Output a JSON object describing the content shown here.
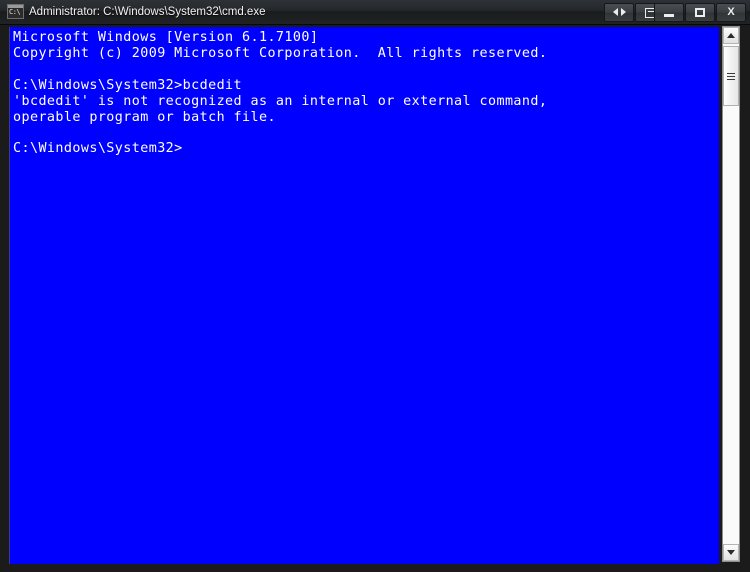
{
  "window": {
    "title": "Administrator: C:\\Windows\\System32\\cmd.exe",
    "icon_name": "cmd-console-icon",
    "icon_label": "C:\\",
    "background_color": "#0000ff",
    "titlebar_color": "#24272a",
    "text_color": "#ffffff"
  },
  "connection_bar": {
    "buttons": [
      {
        "name": "restore-arrows-button",
        "label": "Restore size",
        "glyph": "arrows-left-right-icon"
      },
      {
        "name": "disconnect-button",
        "label": "Disconnect",
        "glyph": "box-arrow-icon"
      }
    ]
  },
  "window_controls": {
    "minimize": {
      "label": "Minimize",
      "glyph": "minimize-icon"
    },
    "maximize": {
      "label": "Maximize",
      "glyph": "maximize-icon"
    },
    "close": {
      "label": "Close",
      "glyph": "close-icon",
      "symbol": "X"
    }
  },
  "terminal": {
    "lines": [
      "Microsoft Windows [Version 6.1.7100]",
      "Copyright (c) 2009 Microsoft Corporation.  All rights reserved.",
      "",
      "C:\\Windows\\System32>bcdedit",
      "'bcdedit' is not recognized as an internal or external command,",
      "operable program or batch file.",
      "",
      "C:\\Windows\\System32>"
    ],
    "content": "Microsoft Windows [Version 6.1.7100]\nCopyright (c) 2009 Microsoft Corporation.  All rights reserved.\n\nC:\\Windows\\System32>bcdedit\n'bcdedit' is not recognized as an internal or external command,\noperable program or batch file.\n\nC:\\Windows\\System32>",
    "os_name": "Microsoft Windows",
    "os_version": "6.1.7100",
    "copyright_year": "2009",
    "working_directory": "C:\\Windows\\System32",
    "command_entered": "bcdedit",
    "error_message": "'bcdedit' is not recognized as an internal or external command, operable program or batch file."
  },
  "scrollbar": {
    "up_arrow": "scroll-up-icon",
    "down_arrow": "scroll-down-icon",
    "thumb": "scroll-thumb"
  }
}
